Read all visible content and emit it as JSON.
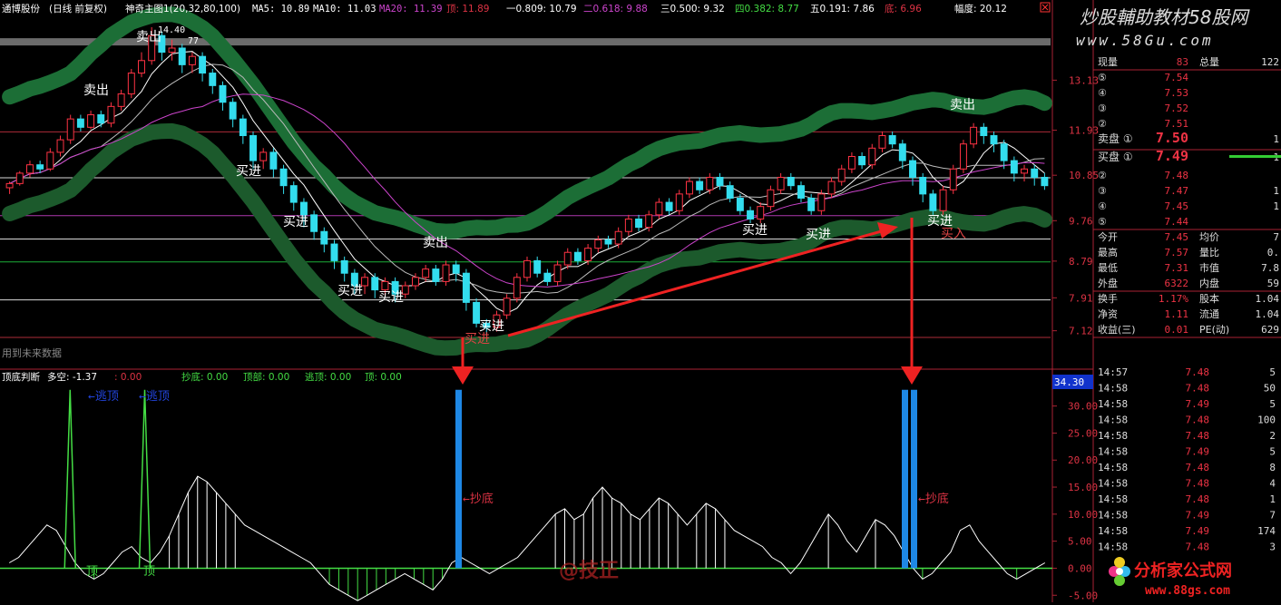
{
  "header": {
    "stock": "通博股份",
    "period": "(日线 前复权)",
    "indicator": "神奇主图1(20,32,80,100)",
    "ma5": "MA5: 10.89",
    "ma10": "MA10: 11.03",
    "ma20": "MA20: 11.39",
    "top_label": "顶: 11.89",
    "one": "一0.809: 10.79",
    "two": "二0.618: 9.88",
    "three": "三0.500: 9.32",
    "four": "四0.382: 8.77",
    "five": "五0.191: 7.86",
    "bottom_label": "底: 6.96",
    "amplitude": "幅度: 20.12"
  },
  "watermark": {
    "top": "炒股輔助教材58股网",
    "url": "www.58Gu.com",
    "bottom": "分析家公式网",
    "bottom_url": "www.88gs.com",
    "center": "@技正"
  },
  "future_data_note": "用到未来数据",
  "sub_header": {
    "title": "顶底判断",
    "duokong": "多空: -1.37",
    "v2": ": 0.00",
    "chaodi": "抄底: 0.00",
    "dingbu": "顶部: 0.00",
    "taoding": "逃顶: 0.00",
    "ding": "顶: 0.00"
  },
  "annotations": {
    "sell1": "卖出",
    "sell2": "卖出",
    "sell3": "卖出",
    "sell4": "卖出",
    "buy1": "买进",
    "buy2": "买进",
    "buy3": "买进",
    "buy4": "买进",
    "buy5": "买进",
    "buy6": "买进",
    "buy7": "买进",
    "buy8": "买进",
    "buy9": "买进",
    "buy10": "买入",
    "high_price": "14.40",
    "high_tail": "77",
    "escape1": "←逃顶",
    "escape2": "←逃顶",
    "ding1": "顶",
    "ding2": "顶",
    "chaodi1": "←抄底",
    "chaodi2": "←抄底"
  },
  "chart_data": [
    {
      "type": "candlestick",
      "title": "通博股份 (日线 前复权)",
      "y_ticks": [
        13.13,
        11.93,
        10.85,
        9.76,
        8.79,
        7.91,
        7.12
      ],
      "ylim": [
        6.96,
        14.4
      ],
      "levels": [
        {
          "value": 11.89,
          "color": "#cc3344"
        },
        {
          "value": 10.79,
          "color": "#ffffff"
        },
        {
          "value": 9.88,
          "color": "#cc44cc"
        },
        {
          "value": 9.32,
          "color": "#ffffff"
        },
        {
          "value": 8.77,
          "color": "#22cc44"
        },
        {
          "value": 7.86,
          "color": "#ffffff"
        },
        {
          "value": 6.96,
          "color": "#cc3344"
        },
        {
          "value": 14.05,
          "color": "#999999"
        }
      ],
      "series": [
        {
          "name": "MA5",
          "color": "#ffffff"
        },
        {
          "name": "MA10",
          "color": "#ffffff"
        },
        {
          "name": "MA20",
          "color": "#cc44cc"
        }
      ],
      "candles": [
        [
          10.55,
          10.65,
          10.4,
          10.7
        ],
        [
          10.65,
          10.9,
          10.6,
          10.95
        ],
        [
          10.9,
          11.1,
          10.8,
          11.2
        ],
        [
          11.1,
          11.0,
          10.9,
          11.2
        ],
        [
          11.0,
          11.4,
          10.95,
          11.5
        ],
        [
          11.4,
          11.7,
          11.3,
          11.8
        ],
        [
          11.7,
          12.2,
          11.6,
          12.3
        ],
        [
          12.2,
          12.0,
          11.9,
          12.3
        ],
        [
          12.0,
          12.3,
          11.95,
          12.4
        ],
        [
          12.3,
          12.1,
          12.0,
          12.4
        ],
        [
          12.1,
          12.5,
          12.0,
          12.6
        ],
        [
          12.5,
          12.8,
          12.4,
          12.9
        ],
        [
          12.8,
          13.3,
          12.7,
          13.4
        ],
        [
          13.3,
          13.6,
          13.2,
          13.8
        ],
        [
          13.6,
          14.2,
          13.5,
          14.4
        ],
        [
          14.2,
          13.8,
          13.6,
          14.3
        ],
        [
          13.8,
          13.9,
          13.6,
          14.1
        ],
        [
          13.9,
          13.5,
          13.3,
          14.0
        ],
        [
          13.5,
          13.7,
          13.3,
          13.8
        ],
        [
          13.7,
          13.3,
          13.1,
          13.8
        ],
        [
          13.3,
          13.0,
          12.8,
          13.4
        ],
        [
          13.0,
          12.6,
          12.4,
          13.1
        ],
        [
          12.6,
          12.2,
          12.0,
          12.7
        ],
        [
          12.2,
          11.8,
          11.6,
          12.3
        ],
        [
          11.8,
          11.2,
          11.0,
          11.9
        ],
        [
          11.2,
          11.4,
          11.0,
          11.5
        ],
        [
          11.4,
          11.0,
          10.8,
          11.5
        ],
        [
          11.0,
          10.6,
          10.4,
          11.1
        ],
        [
          10.6,
          10.2,
          10.0,
          10.7
        ],
        [
          10.2,
          9.9,
          9.6,
          10.3
        ],
        [
          9.9,
          9.5,
          9.3,
          10.0
        ],
        [
          9.5,
          9.2,
          9.0,
          9.6
        ],
        [
          9.2,
          8.8,
          8.6,
          9.3
        ],
        [
          8.8,
          8.5,
          8.3,
          8.9
        ],
        [
          8.5,
          8.2,
          8.0,
          8.6
        ],
        [
          8.2,
          8.4,
          8.0,
          8.5
        ],
        [
          8.4,
          8.1,
          7.9,
          8.5
        ],
        [
          8.1,
          8.3,
          7.95,
          8.4
        ],
        [
          8.3,
          8.0,
          7.8,
          8.4
        ],
        [
          8.0,
          8.2,
          7.9,
          8.3
        ],
        [
          8.2,
          8.4,
          8.1,
          8.5
        ],
        [
          8.4,
          8.6,
          8.3,
          8.7
        ],
        [
          8.6,
          8.3,
          8.2,
          8.7
        ],
        [
          8.3,
          8.7,
          8.2,
          8.8
        ],
        [
          8.7,
          8.5,
          8.3,
          8.8
        ],
        [
          8.5,
          7.8,
          7.6,
          8.6
        ],
        [
          7.8,
          7.3,
          7.2,
          7.9
        ],
        [
          7.3,
          7.2,
          7.0,
          7.4
        ],
        [
          7.2,
          7.5,
          7.1,
          7.6
        ],
        [
          7.5,
          7.9,
          7.4,
          8.0
        ],
        [
          7.9,
          8.4,
          7.8,
          8.5
        ],
        [
          8.4,
          8.8,
          8.3,
          8.9
        ],
        [
          8.8,
          8.5,
          8.4,
          8.9
        ],
        [
          8.5,
          8.3,
          8.2,
          8.6
        ],
        [
          8.3,
          8.7,
          8.2,
          8.8
        ],
        [
          8.7,
          9.0,
          8.6,
          9.1
        ],
        [
          9.0,
          8.8,
          8.7,
          9.1
        ],
        [
          8.8,
          9.1,
          8.7,
          9.2
        ],
        [
          9.1,
          9.3,
          9.0,
          9.4
        ],
        [
          9.3,
          9.2,
          9.1,
          9.4
        ],
        [
          9.2,
          9.5,
          9.1,
          9.6
        ],
        [
          9.5,
          9.8,
          9.4,
          9.9
        ],
        [
          9.8,
          9.6,
          9.5,
          9.9
        ],
        [
          9.6,
          9.9,
          9.5,
          10.0
        ],
        [
          9.9,
          10.2,
          9.8,
          10.3
        ],
        [
          10.2,
          10.0,
          9.9,
          10.3
        ],
        [
          10.0,
          10.4,
          9.9,
          10.5
        ],
        [
          10.4,
          10.7,
          10.3,
          10.8
        ],
        [
          10.7,
          10.5,
          10.4,
          10.8
        ],
        [
          10.5,
          10.8,
          10.4,
          10.9
        ],
        [
          10.8,
          10.6,
          10.5,
          10.9
        ],
        [
          10.6,
          10.3,
          10.2,
          10.7
        ],
        [
          10.3,
          10.0,
          9.9,
          10.4
        ],
        [
          10.0,
          9.8,
          9.7,
          10.1
        ],
        [
          9.8,
          10.1,
          9.7,
          10.2
        ],
        [
          10.1,
          10.5,
          10.0,
          10.6
        ],
        [
          10.5,
          10.8,
          10.4,
          10.9
        ],
        [
          10.8,
          10.6,
          10.5,
          10.9
        ],
        [
          10.6,
          10.3,
          10.2,
          10.7
        ],
        [
          10.3,
          10.0,
          9.9,
          10.4
        ],
        [
          10.0,
          10.4,
          9.9,
          10.5
        ],
        [
          10.4,
          10.7,
          10.3,
          10.8
        ],
        [
          10.7,
          11.0,
          10.6,
          11.1
        ],
        [
          11.0,
          11.3,
          10.9,
          11.4
        ],
        [
          11.3,
          11.1,
          11.0,
          11.4
        ],
        [
          11.1,
          11.5,
          11.0,
          11.6
        ],
        [
          11.5,
          11.8,
          11.4,
          11.9
        ],
        [
          11.8,
          11.6,
          11.5,
          11.9
        ],
        [
          11.6,
          11.2,
          11.0,
          11.7
        ],
        [
          11.2,
          10.8,
          10.6,
          11.3
        ],
        [
          10.8,
          10.4,
          10.2,
          10.9
        ],
        [
          10.4,
          10.0,
          9.9,
          10.5
        ],
        [
          10.0,
          10.5,
          9.9,
          10.6
        ],
        [
          10.5,
          11.0,
          10.4,
          11.1
        ],
        [
          11.0,
          11.6,
          10.9,
          11.7
        ],
        [
          11.6,
          12.0,
          11.5,
          12.1
        ],
        [
          12.0,
          11.8,
          11.6,
          12.1
        ],
        [
          11.8,
          11.6,
          11.4,
          11.9
        ],
        [
          11.6,
          11.2,
          11.0,
          11.7
        ],
        [
          11.2,
          10.9,
          10.7,
          11.3
        ],
        [
          10.9,
          11.0,
          10.7,
          11.1
        ],
        [
          11.0,
          10.8,
          10.6,
          11.1
        ],
        [
          10.8,
          10.6,
          10.5,
          10.9
        ]
      ]
    },
    {
      "type": "line",
      "title": "顶底判断",
      "y_ticks": [
        30.0,
        25.0,
        20.0,
        15.0,
        10.0,
        5.0,
        0.0,
        -5.0
      ],
      "ylim": [
        -6.3,
        34.3
      ],
      "highlight_tick": "34.30",
      "series": [
        {
          "name": "多空",
          "color": "#ffffff",
          "values": [
            1,
            2,
            4,
            6,
            8,
            7,
            4,
            1,
            -1,
            -2,
            -1,
            1,
            3,
            4,
            2,
            1,
            3,
            6,
            10,
            14,
            17,
            16,
            14,
            12,
            10,
            8,
            7,
            6,
            5,
            4,
            3,
            2,
            1,
            -1,
            -3,
            -4,
            -5,
            -6,
            -5,
            -4,
            -3,
            -2,
            -1,
            -2,
            -3,
            -4,
            -2,
            1,
            2,
            1,
            0,
            -1,
            0,
            1,
            2,
            4,
            6,
            8,
            10,
            11,
            9,
            10,
            13,
            15,
            13,
            12,
            10,
            9,
            11,
            13,
            12,
            10,
            8,
            10,
            12,
            11,
            9,
            7,
            6,
            5,
            4,
            2,
            1,
            -1,
            1,
            4,
            7,
            10,
            8,
            5,
            3,
            6,
            9,
            8,
            6,
            3,
            0,
            -2,
            -1,
            1,
            3,
            7,
            8,
            5,
            3,
            1,
            -1,
            -2,
            -1,
            0,
            1
          ]
        },
        {
          "name": "顶",
          "color": "#44dd44",
          "values": [
            0,
            0,
            0,
            0,
            0,
            33,
            0,
            0,
            0,
            0,
            0,
            0,
            0,
            0,
            0,
            33,
            0,
            0,
            0,
            0,
            0,
            0,
            0,
            0,
            0,
            0,
            0,
            0,
            0,
            0,
            0,
            0,
            0,
            0,
            0,
            0,
            0,
            0,
            0,
            0,
            0,
            0,
            0,
            0,
            0,
            0,
            0,
            0,
            0,
            0,
            0,
            0,
            0,
            0,
            0,
            0,
            0,
            0,
            0,
            0,
            0,
            0,
            0,
            0,
            0,
            0,
            0,
            0,
            0,
            0,
            0,
            0,
            0,
            0,
            0,
            0,
            0,
            0,
            0,
            0,
            0,
            0,
            0,
            0,
            0,
            0,
            0,
            0,
            0,
            0,
            0,
            0,
            0,
            0,
            0,
            0,
            0,
            0,
            0,
            0,
            0,
            0,
            0,
            0,
            0,
            0,
            0,
            0,
            0,
            0
          ]
        },
        {
          "name": "抄底",
          "color": "#2277dd",
          "bars": [
            505,
            997,
            1007
          ]
        }
      ]
    }
  ]
}
